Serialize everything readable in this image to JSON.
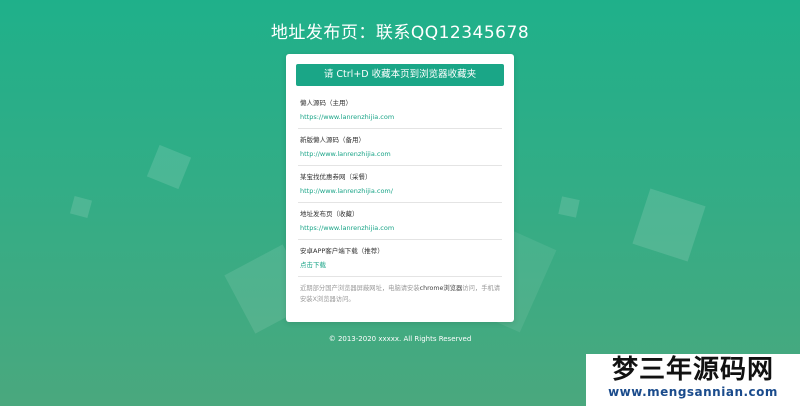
{
  "title": "地址发布页：联系QQ12345678",
  "bookmark_label": "请 Ctrl+D 收藏本页到浏览器收藏夹",
  "entries": [
    {
      "name": "懒人源码（主用）",
      "link": "https://www.lanrenzhijia.com"
    },
    {
      "name": "新版懒人源码（备用）",
      "link": "http://www.lanrenzhijia.com"
    },
    {
      "name": "某宝找优惠券网（采餐）",
      "link": "http://www.lanrenzhijia.com/"
    },
    {
      "name": "地址发布页（收藏）",
      "link": "https://www.lanrenzhijia.com"
    },
    {
      "name": "安卓APP客户端下载（推荐）",
      "link": "点击下载"
    }
  ],
  "note": {
    "before": "近期部分国产浏览器屏蔽网址，电脑请安装",
    "highlight": "chrome浏览器",
    "after": "访问，手机请安装X浏览器访问。"
  },
  "footer": "© 2013-2020 xxxxx. All Rights Reserved",
  "watermark": {
    "cn": "梦三年源码网",
    "en": "www.mengsannian.com"
  }
}
